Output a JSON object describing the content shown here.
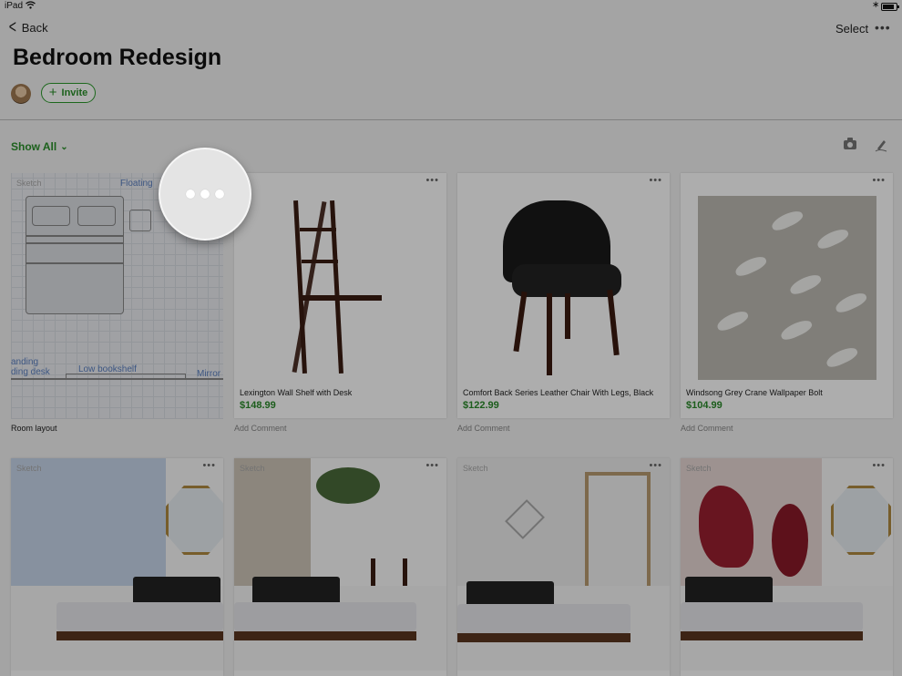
{
  "status_bar": {
    "device": "iPad",
    "wifi_icon": "wifi-icon",
    "bluetooth_icon": "bluetooth-icon",
    "battery_icon": "battery-icon"
  },
  "nav": {
    "back_label": "Back",
    "select_label": "Select",
    "more_icon": "more-icon"
  },
  "page": {
    "title": "Bedroom Redesign",
    "invite_label": "Invite"
  },
  "filter": {
    "label": "Show All"
  },
  "toolbar": {
    "camera_icon": "camera-icon",
    "pen_icon": "pen-icon"
  },
  "cards_row1": [
    {
      "tag": "Sketch",
      "caption": "Room layout",
      "labels": [
        "Floating",
        "anding",
        "ding desk",
        "Low bookshelf",
        "Mirror"
      ]
    },
    {
      "name": "Lexington Wall Shelf with Desk",
      "price": "$148.99",
      "comment": "Add Comment"
    },
    {
      "name": "Comfort Back Series Leather Chair With Legs, Black",
      "price": "$122.99",
      "comment": "Add Comment"
    },
    {
      "name": "Windsong Grey Crane Wallpaper Bolt",
      "price": "$104.99",
      "comment": "Add Comment"
    }
  ],
  "cards_row2": [
    {
      "tag": "Sketch"
    },
    {
      "tag": "Sketch"
    },
    {
      "tag": "Sketch"
    },
    {
      "tag": "Sketch"
    }
  ],
  "more_glyph": "•••",
  "colors": {
    "accent_green": "#2a8f2a",
    "background": "#f2f2f2"
  }
}
